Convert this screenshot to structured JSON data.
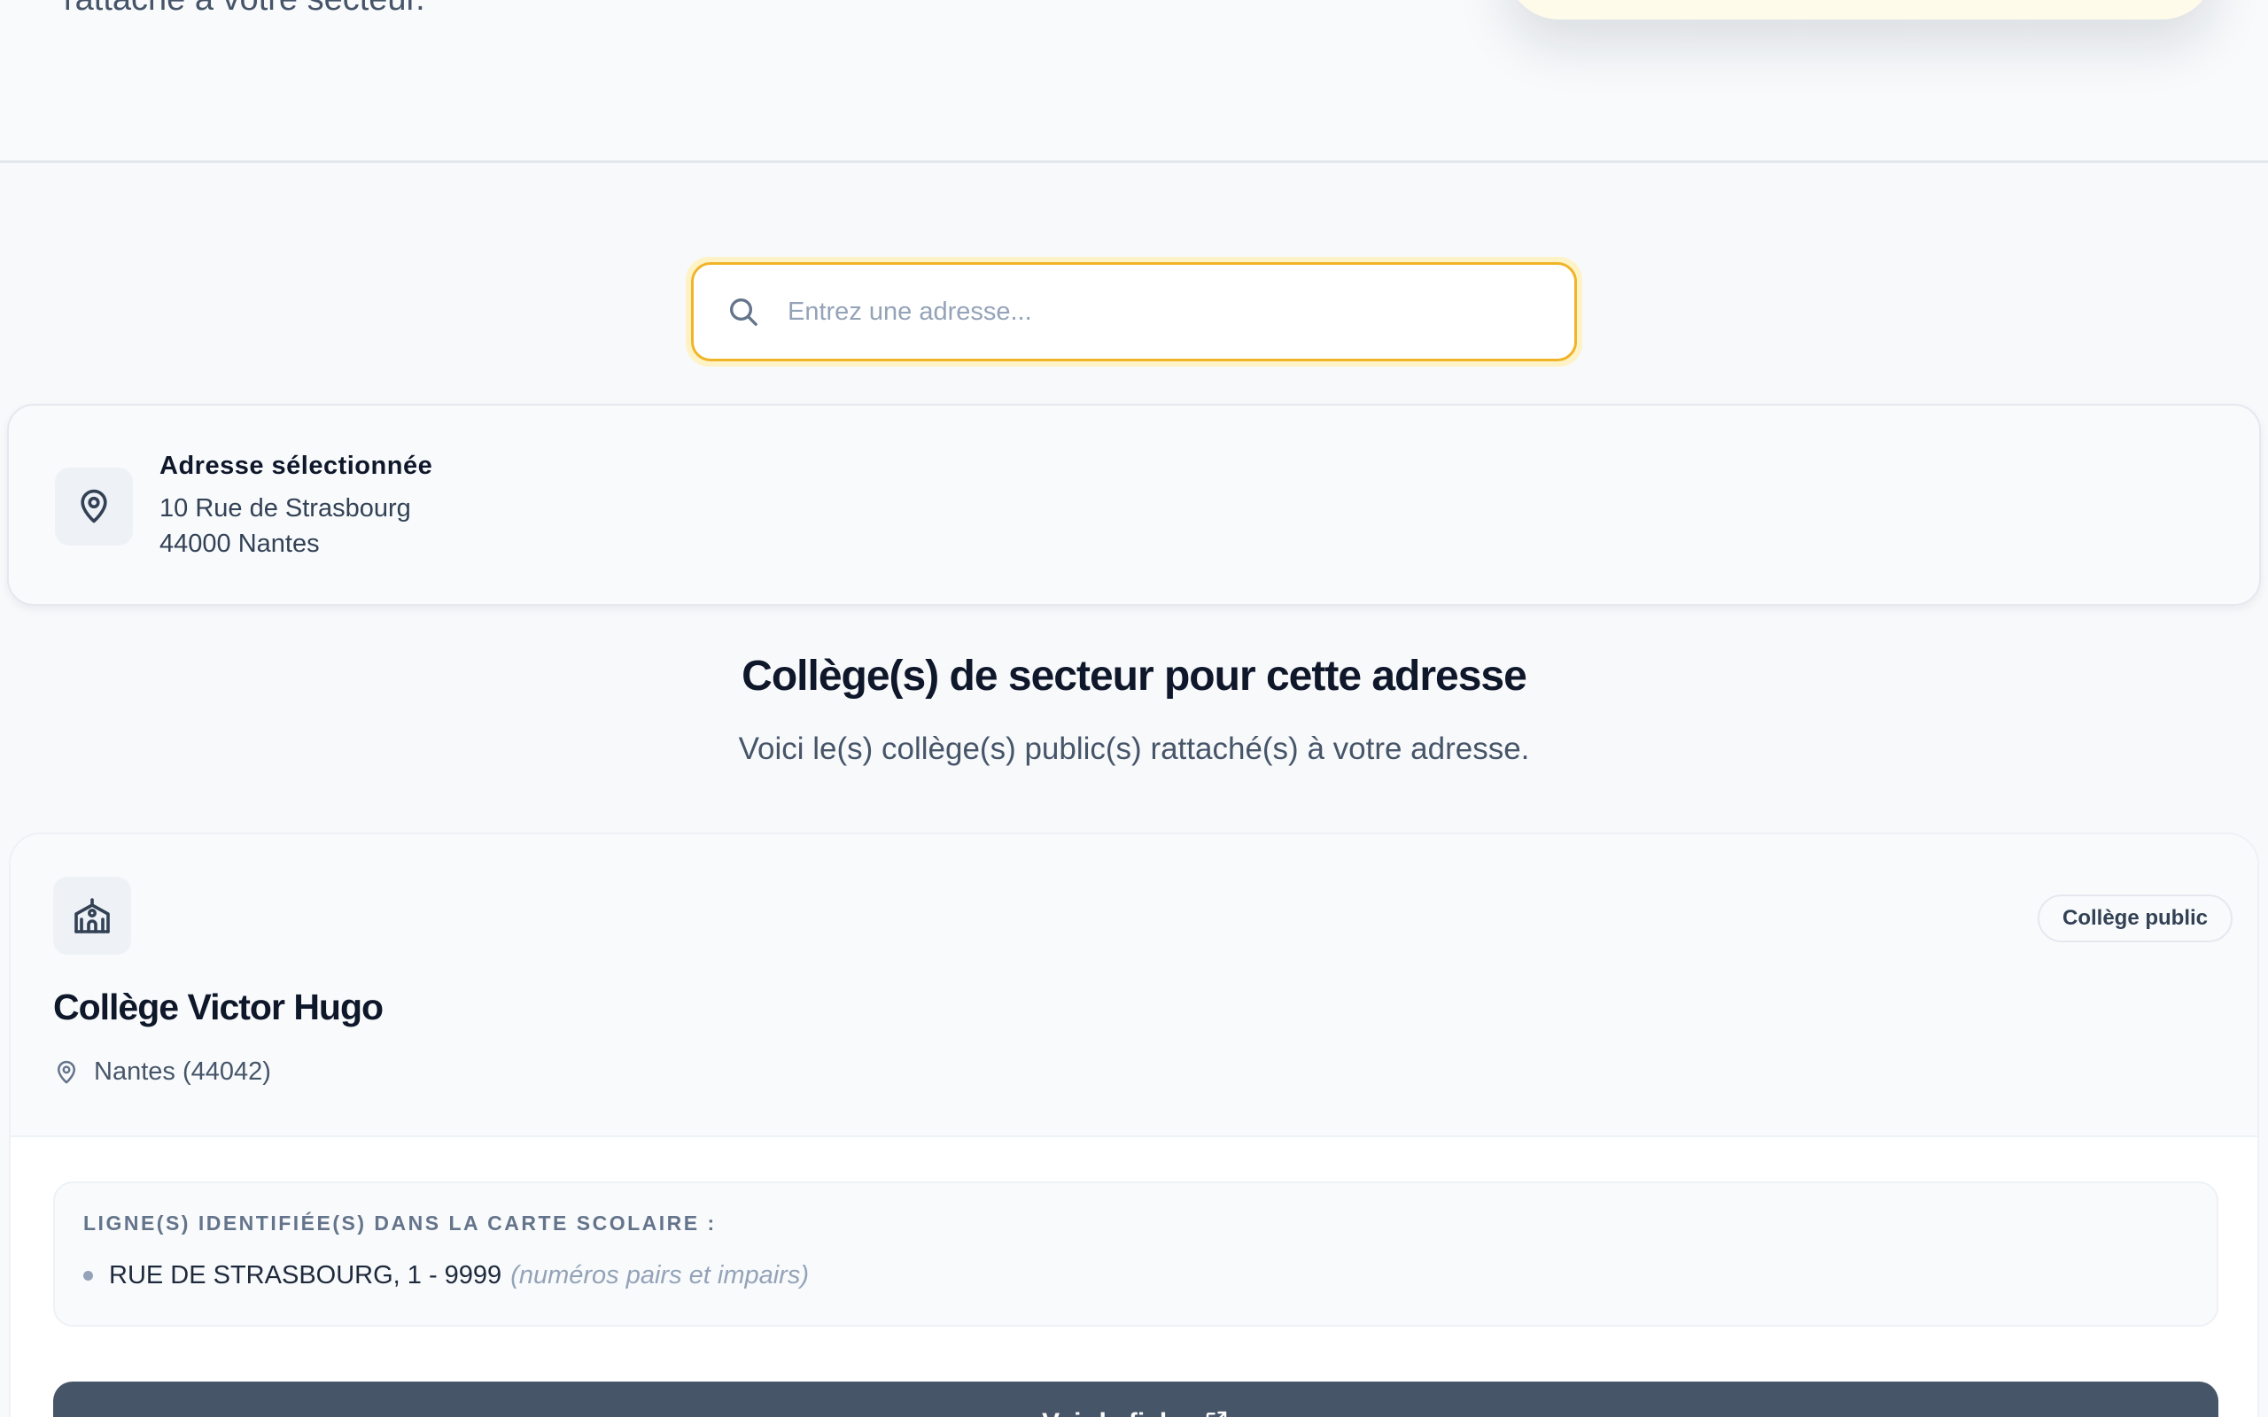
{
  "hero": {
    "subtitle": "rattaché à votre secteur."
  },
  "search": {
    "placeholder": "Entrez une adresse...",
    "value": ""
  },
  "selected_address": {
    "label": "Adresse sélectionnée",
    "line1": "10 Rue de Strasbourg",
    "line2": "44000 Nantes"
  },
  "results": {
    "title": "Collège(s) de secteur pour cette adresse",
    "subtitle": "Voici le(s) collège(s) public(s) rattaché(s) à votre adresse."
  },
  "school": {
    "badge": "Collège public",
    "name": "Collège Victor Hugo",
    "city": "Nantes (44042)",
    "lines_title": "LIGNE(S) IDENTIFIÉE(S) DANS LA CARTE SCOLAIRE :",
    "lines": [
      {
        "street": "RUE DE STRASBOURG, 1 - 9999",
        "note": "(numéros pairs et impairs)"
      }
    ],
    "cta_label": "Voir la fiche"
  },
  "colors": {
    "accent": "#f0b429",
    "cta": "#475569",
    "background": "#f7f9fb"
  },
  "icons": [
    "search-icon",
    "map-pin-icon",
    "school-icon",
    "external-link-icon"
  ]
}
